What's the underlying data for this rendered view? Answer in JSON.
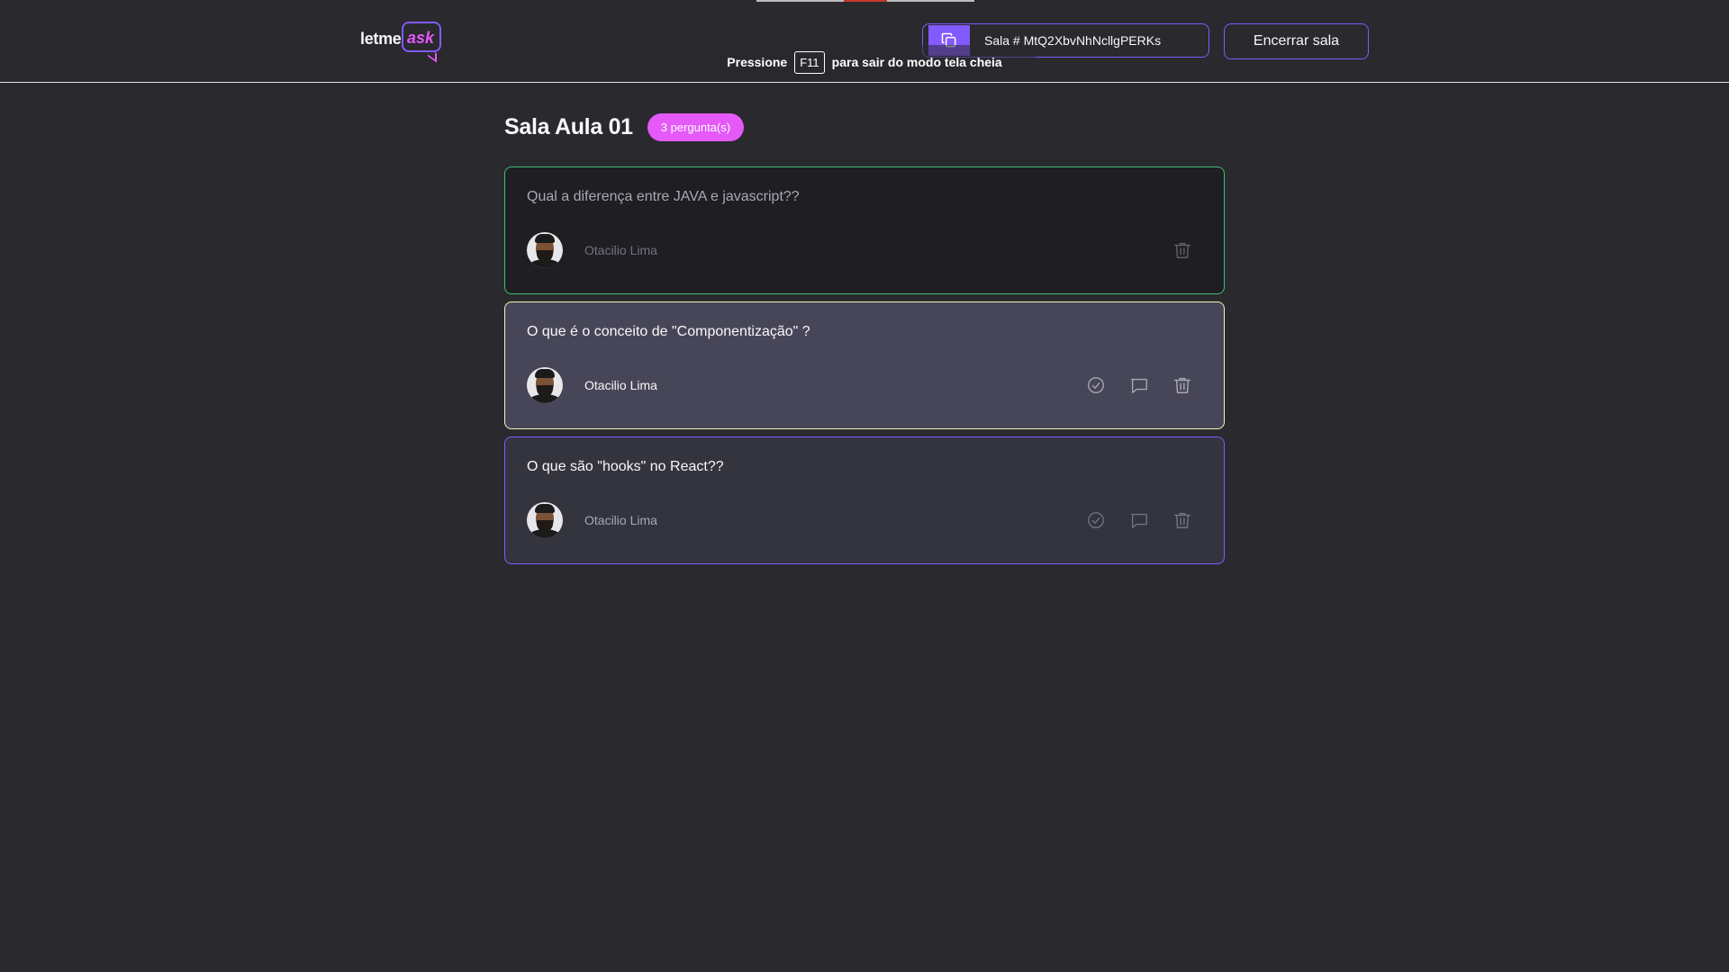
{
  "logo": {
    "text_prefix": "letme",
    "text_accent": "ask"
  },
  "header": {
    "room_code_label": "Sala # MtQ2XbvNhNcllgPERKs",
    "end_room_label": "Encerrar sala",
    "copy_icon": "copy-icon"
  },
  "fullscreen_notice": {
    "prefix": "Pressione",
    "key": "F11",
    "suffix": "para sair do modo tela cheia"
  },
  "room": {
    "title": "Sala Aula 01",
    "question_count": "3 pergunta(s)"
  },
  "questions": [
    {
      "content": "Qual a diferença entre JAVA e javascript??",
      "author": "Otacilio Lima",
      "state": "answered",
      "actions": [
        "trash-icon"
      ]
    },
    {
      "content": "O que é o conceito de \"Componentização\" ?",
      "author": "Otacilio Lima",
      "state": "highlighted",
      "actions": [
        "check-circle-icon",
        "answer-icon",
        "trash-icon"
      ]
    },
    {
      "content": "O que são \"hooks\" no React??",
      "author": "Otacilio Lima",
      "state": "default",
      "actions": [
        "check-circle-icon",
        "answer-icon",
        "trash-icon"
      ]
    }
  ],
  "colors": {
    "background": "#29292e",
    "accent_purple": "#835afd",
    "accent_pink": "#e559f9",
    "answered_border": "#3fbf6f",
    "highlighted_border": "#f5f5b8"
  }
}
